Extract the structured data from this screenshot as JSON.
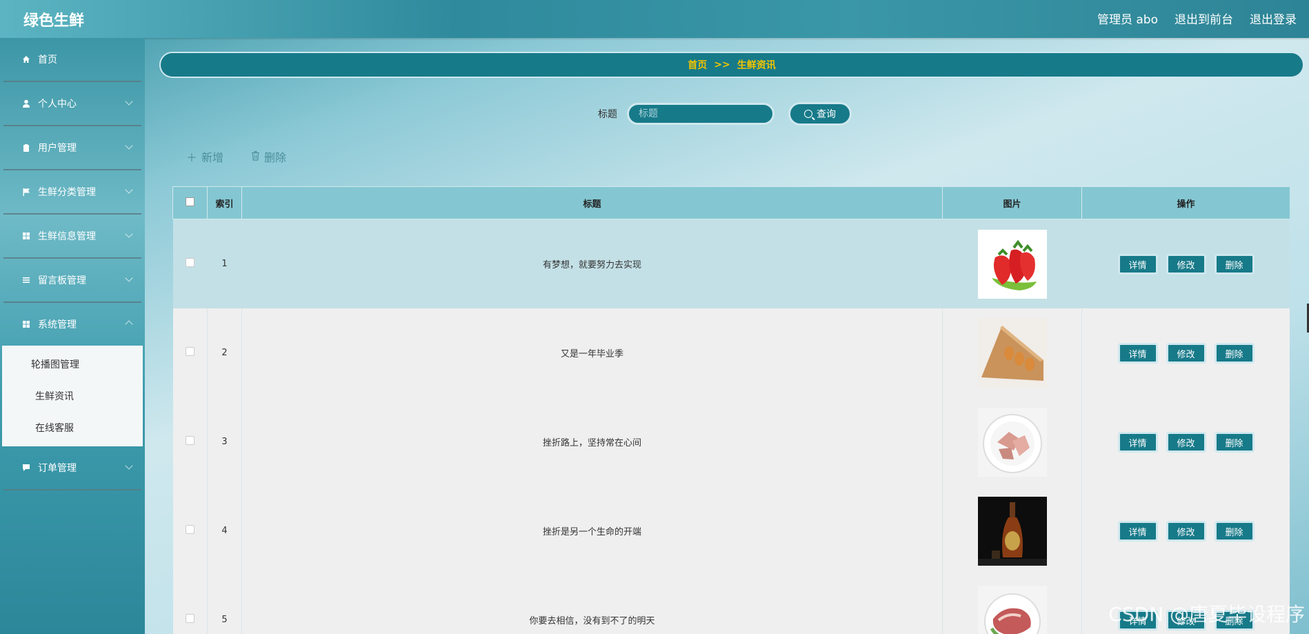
{
  "app": {
    "title": "绿色生鲜"
  },
  "topbar": {
    "user": "管理员 abo",
    "to_front": "退出到前台",
    "logout": "退出登录"
  },
  "sidebar": {
    "items": [
      {
        "label": "首页",
        "icon": "home-icon"
      },
      {
        "label": "个人中心",
        "icon": "user-icon"
      },
      {
        "label": "用户管理",
        "icon": "clipboard-icon"
      },
      {
        "label": "生鲜分类管理",
        "icon": "flag-icon"
      },
      {
        "label": "生鲜信息管理",
        "icon": "grid-icon"
      },
      {
        "label": "留言板管理",
        "icon": "list-icon"
      },
      {
        "label": "系统管理",
        "icon": "grid-icon"
      }
    ],
    "submenu": [
      "轮播图管理",
      "生鲜资讯",
      "在线客服"
    ],
    "after": {
      "label": "订单管理",
      "icon": "chat-icon"
    }
  },
  "breadcrumb": {
    "home": "首页",
    "sep": ">>",
    "current": "生鲜资讯"
  },
  "search": {
    "label": "标题",
    "placeholder": "标题",
    "button": "查询"
  },
  "actions": {
    "add": "新增",
    "delete": "删除"
  },
  "table": {
    "headers": {
      "index": "索引",
      "title": "标题",
      "image": "图片",
      "ops": "操作"
    },
    "ops": {
      "detail": "详情",
      "edit": "修改",
      "delete": "删除"
    },
    "rows": [
      {
        "index": "1",
        "title": "有梦想，就要努力去实现",
        "image": "strawberries"
      },
      {
        "index": "2",
        "title": "又是一年毕业季",
        "image": "eggs"
      },
      {
        "index": "3",
        "title": "挫折路上，坚持常在心间",
        "image": "meat-plate"
      },
      {
        "index": "4",
        "title": "挫折是另一个生命的开端",
        "image": "wine-bottle"
      },
      {
        "index": "5",
        "title": "你要去相信，没有到不了的明天",
        "image": "ham-plate"
      }
    ]
  },
  "watermark": "CSDN @唐夏毕设程序"
}
